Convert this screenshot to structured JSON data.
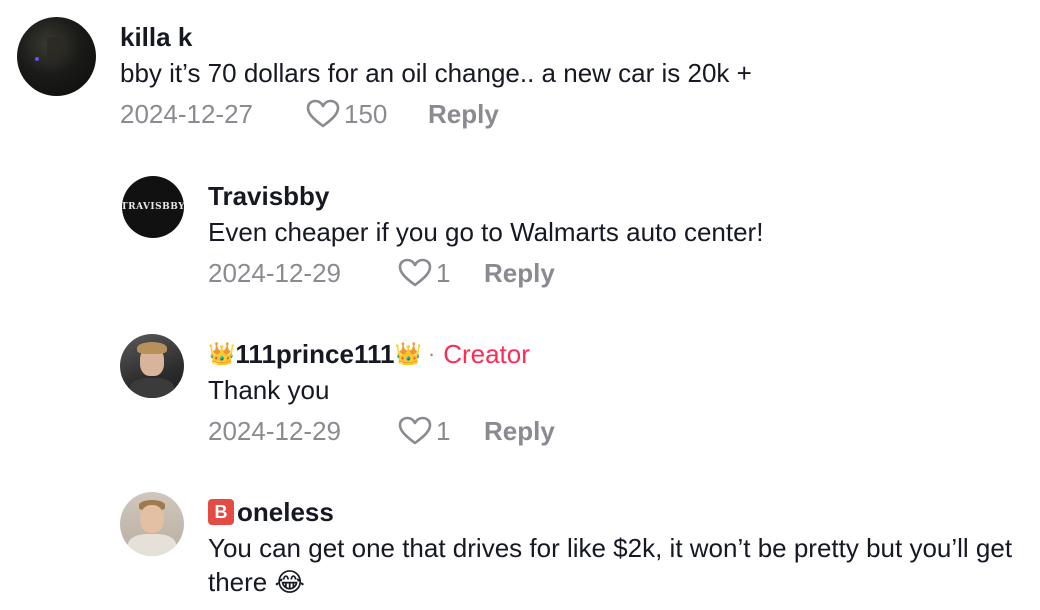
{
  "comments": [
    {
      "username": "killa k",
      "text": "bby it’s 70 dollars for an oil change.. a new car is 20k +",
      "date": "2024-12-27",
      "likes": "150",
      "reply_label": "Reply",
      "avatar_icon": "dark-night-photo-avatar"
    },
    {
      "username": "Travisbby",
      "avatar_text": "TRAVISBBY",
      "text": "Even cheaper if you go to Walmarts auto center!",
      "date": "2024-12-29",
      "likes": "1",
      "reply_label": "Reply"
    },
    {
      "username": "111prince111",
      "username_prefix": "👑",
      "username_suffix": "👑",
      "separator": "·",
      "badge": "Creator",
      "text": "Thank you",
      "date": "2024-12-29",
      "likes": "1",
      "reply_label": "Reply",
      "avatar_icon": "person-photo-avatar"
    },
    {
      "username": "oneless",
      "username_badge": "B",
      "text": "You can get one that drives for like $2k, it won’t be pretty but you’ll get there 😂",
      "avatar_icon": "person-photo-avatar"
    }
  ],
  "colors": {
    "text": "#161823",
    "muted": "#8a8b91",
    "creator": "#fe2c55",
    "badge_bg": "#e34b43"
  }
}
